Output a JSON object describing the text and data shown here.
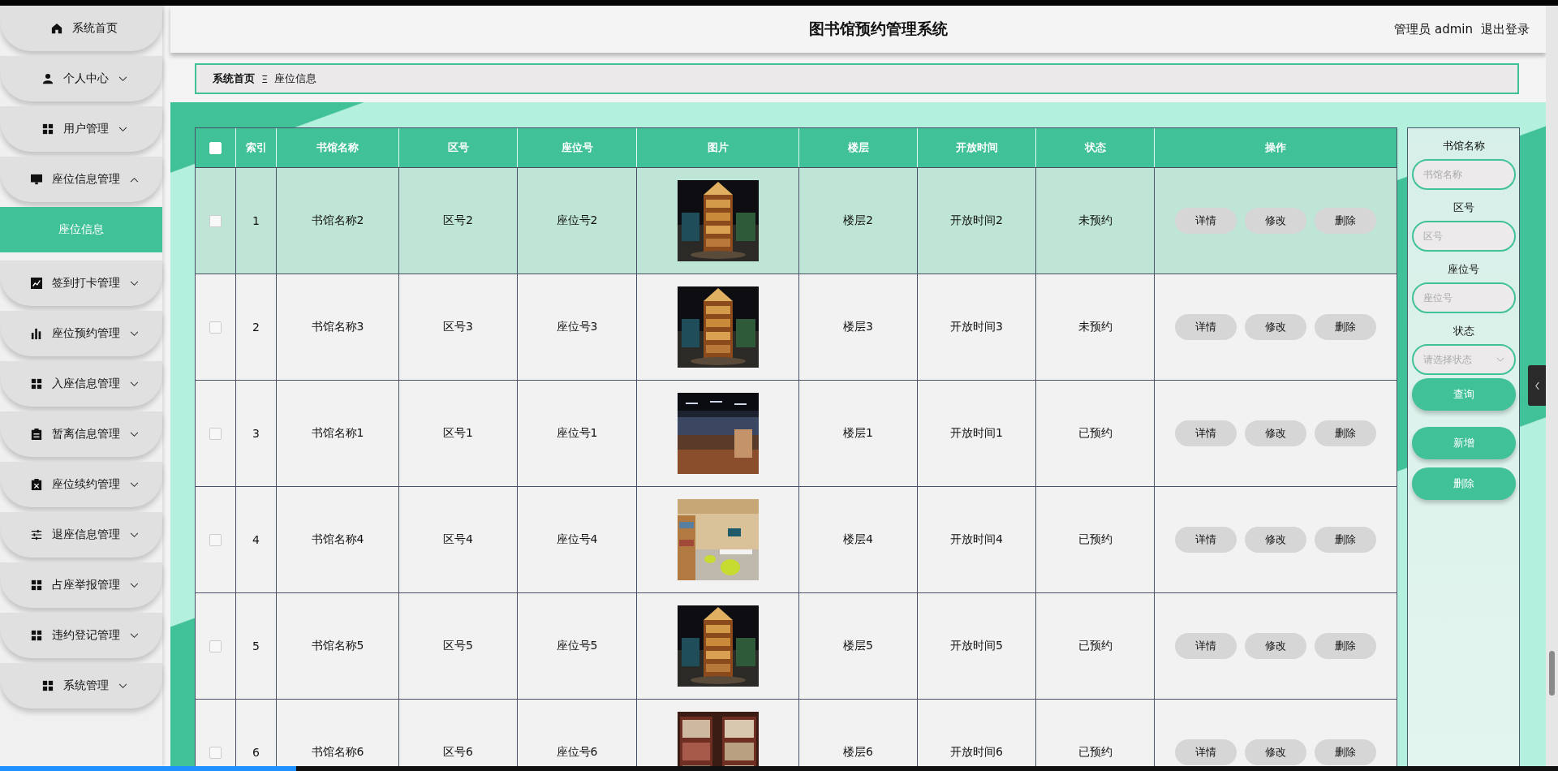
{
  "sidebar": {
    "items": [
      {
        "label": "系统首页"
      },
      {
        "label": "个人中心",
        "expanded": false
      },
      {
        "label": "用户管理",
        "expanded": false
      },
      {
        "label": "座位信息管理",
        "expanded": true,
        "children": [
          {
            "label": "座位信息",
            "selected": true
          }
        ]
      },
      {
        "label": "签到打卡管理",
        "expanded": false
      },
      {
        "label": "座位预约管理",
        "expanded": false
      },
      {
        "label": "入座信息管理",
        "expanded": false
      },
      {
        "label": "暂离信息管理",
        "expanded": false
      },
      {
        "label": "座位续约管理",
        "expanded": false
      },
      {
        "label": "退座信息管理",
        "expanded": false
      },
      {
        "label": "占座举报管理",
        "expanded": false
      },
      {
        "label": "违约登记管理",
        "expanded": false
      },
      {
        "label": "系统管理",
        "expanded": false
      }
    ]
  },
  "header": {
    "title": "图书馆预约管理系统",
    "user": "管理员 admin",
    "logout": "退出登录"
  },
  "breadcrumb": {
    "home": "系统首页",
    "separator": "Ξ",
    "current": "座位信息"
  },
  "table": {
    "select_all": {
      "checked": false
    },
    "columns": [
      "索引",
      "书馆名称",
      "区号",
      "座位号",
      "图片",
      "楼层",
      "开放时间",
      "状态",
      "操作"
    ],
    "rows": [
      {
        "checked": false,
        "highlighted": true,
        "index": "1",
        "name": "书馆名称2",
        "zone": "区号2",
        "seat": "座位号2",
        "image": {
          "kind": "picture"
        },
        "floor": "楼层2",
        "hours": "开放时间2",
        "status": "未预约",
        "actions": [
          "详情",
          "修改",
          "删除"
        ]
      },
      {
        "checked": false,
        "highlighted": false,
        "index": "2",
        "name": "书馆名称3",
        "zone": "区号3",
        "seat": "座位号3",
        "image": {
          "kind": "picture"
        },
        "floor": "楼层3",
        "hours": "开放时间3",
        "status": "未预约",
        "actions": [
          "详情",
          "修改",
          "删除"
        ]
      },
      {
        "checked": false,
        "highlighted": false,
        "index": "3",
        "name": "书馆名称1",
        "zone": "区号1",
        "seat": "座位号1",
        "image": {
          "kind": "picture"
        },
        "floor": "楼层1",
        "hours": "开放时间1",
        "status": "已预约",
        "actions": [
          "详情",
          "修改",
          "删除"
        ]
      },
      {
        "checked": false,
        "highlighted": false,
        "index": "4",
        "name": "书馆名称4",
        "zone": "区号4",
        "seat": "座位号4",
        "image": {
          "kind": "picture"
        },
        "floor": "楼层4",
        "hours": "开放时间4",
        "status": "已预约",
        "actions": [
          "详情",
          "修改",
          "删除"
        ]
      },
      {
        "checked": false,
        "highlighted": false,
        "index": "5",
        "name": "书馆名称5",
        "zone": "区号5",
        "seat": "座位号5",
        "image": {
          "kind": "picture"
        },
        "floor": "楼层5",
        "hours": "开放时间5",
        "status": "已预约",
        "actions": [
          "详情",
          "修改",
          "删除"
        ]
      },
      {
        "checked": false,
        "highlighted": false,
        "index": "6",
        "name": "书馆名称6",
        "zone": "区号6",
        "seat": "座位号6",
        "image": {
          "kind": "picture"
        },
        "floor": "楼层6",
        "hours": "开放时间6",
        "status": "已预约",
        "actions": [
          "详情",
          "修改",
          "删除"
        ]
      }
    ]
  },
  "search_panel": {
    "fields": [
      {
        "label": "书馆名称",
        "placeholder": "书馆名称",
        "kind": "text"
      },
      {
        "label": "区号",
        "placeholder": "区号",
        "kind": "text"
      },
      {
        "label": "座位号",
        "placeholder": "座位号",
        "kind": "text"
      },
      {
        "label": "状态",
        "placeholder": "请选择状态",
        "kind": "select"
      }
    ],
    "buttons": [
      "查询",
      "新增",
      "删除"
    ]
  },
  "video_progress": {
    "level": 0.19
  }
}
